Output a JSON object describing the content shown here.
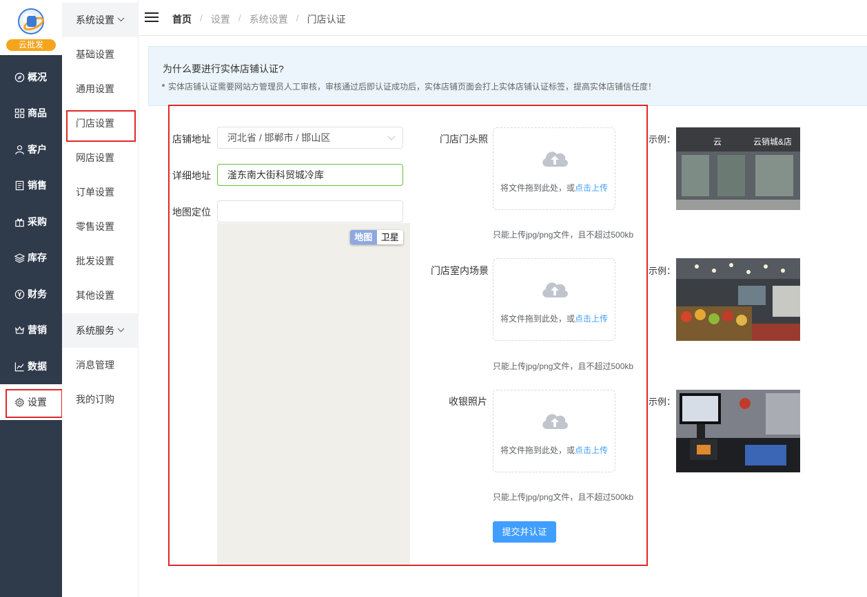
{
  "brand": {
    "badge": "云批发"
  },
  "nav": [
    {
      "label": "概况",
      "icon": "dashboard-icon"
    },
    {
      "label": "商品",
      "icon": "grid-icon"
    },
    {
      "label": "客户",
      "icon": "user-icon"
    },
    {
      "label": "销售",
      "icon": "document-icon"
    },
    {
      "label": "采购",
      "icon": "gift-icon"
    },
    {
      "label": "库存",
      "icon": "layers-icon"
    },
    {
      "label": "财务",
      "icon": "yen-icon"
    },
    {
      "label": "营销",
      "icon": "crown-icon"
    },
    {
      "label": "数据",
      "icon": "chart-icon"
    },
    {
      "label": "设置",
      "icon": "gear-icon"
    }
  ],
  "submenu": {
    "group1": "系统设置",
    "items1": [
      "基础设置",
      "通用设置",
      "门店设置",
      "网店设置",
      "订单设置",
      "零售设置",
      "批发设置",
      "其他设置"
    ],
    "group2": "系统服务",
    "items2": [
      "消息管理",
      "我的订购"
    ]
  },
  "breadcrumb": [
    "首页",
    "设置",
    "系统设置",
    "门店认证"
  ],
  "banner": {
    "title": "为什么要进行实体店铺认证?",
    "desc": "实体店铺认证需要网站方管理员人工审核，审核通过后即认证成功后，实体店铺页面会打上实体店铺认证标签，提高实体店铺信任度！"
  },
  "form": {
    "address_label": "店铺地址",
    "address_value": "河北省 / 邯郸市 / 邯山区",
    "detail_label": "详细地址",
    "detail_value": "滏东南大街科贸城冷库",
    "map_label": "地图定位",
    "map_value": "",
    "map_toggle": {
      "map": "地图",
      "satellite": "卫星"
    }
  },
  "uploads": [
    {
      "label": "门店门头照",
      "text": "将文件拖到此处，或",
      "link": "点击上传",
      "tip": "只能上传jpg/png文件，且不超过500kb",
      "example": "示例："
    },
    {
      "label": "门店室内场景",
      "text": "将文件拖到此处，或",
      "link": "点击上传",
      "tip": "只能上传jpg/png文件，且不超过500kb",
      "example": "示例："
    },
    {
      "label": "收银照片",
      "text": "将文件拖到此处，或",
      "link": "点击上传",
      "tip": "只能上传jpg/png文件，且不超过500kb",
      "example": "示例："
    }
  ],
  "storefront_sign": {
    "left": "云",
    "right": "云销城&店"
  },
  "submit_label": "提交并认证",
  "colors": {
    "sidebar": "#2f3a4b",
    "accent": "#409eff",
    "highlight": "#e02727",
    "brand_badge": "#f4a51c"
  }
}
